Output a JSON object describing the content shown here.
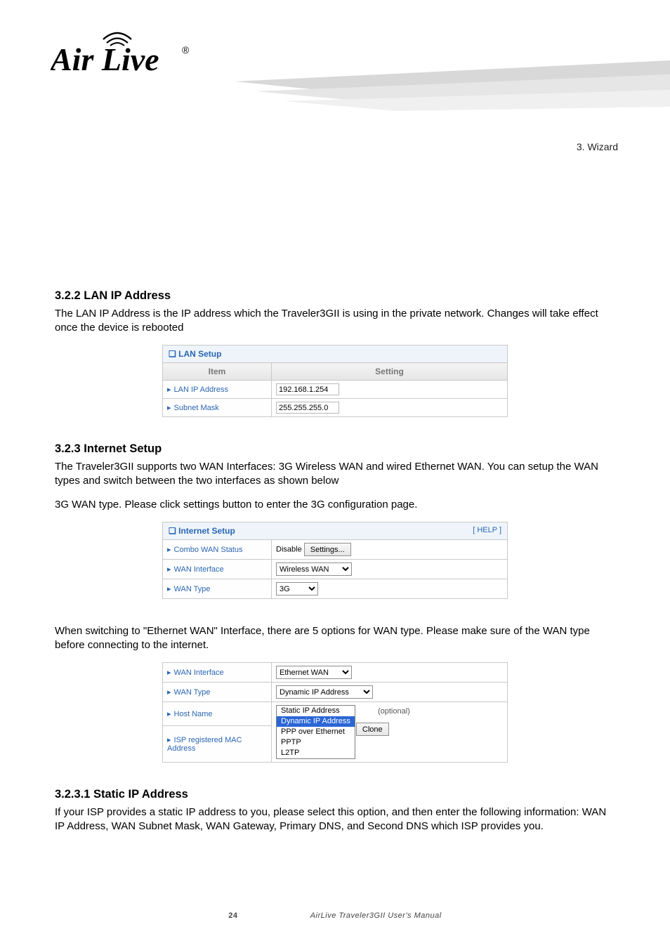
{
  "header": {
    "brand_line1": "Air",
    "brand_line2": "Live",
    "chapter_a": "3. Wizard",
    "chapter_b": ""
  },
  "lan": {
    "section_title": "3.2.2 LAN IP Address",
    "section_body": "The LAN IP Address is the IP address which the Traveler3GII is using in the private network. Changes will take effect once the device is rebooted",
    "panel_title": "LAN Setup",
    "col_item": "Item",
    "col_setting": "Setting",
    "row1_label": "LAN IP Address",
    "row1_value": "192.168.1.254",
    "row2_label": "Subnet Mask",
    "row2_value": "255.255.255.0"
  },
  "internet": {
    "section_title": "3.2.3 Internet Setup",
    "para1": "The Traveler3GII supports two WAN Interfaces: 3G Wireless WAN and wired Ethernet WAN. You can setup the WAN types and switch between the two interfaces as shown below",
    "para2": "3G WAN type. Please click settings button to enter the 3G configuration page.",
    "panel_title": "Internet Setup",
    "help_label": "[ HELP ]",
    "row1_label": "Combo WAN Status",
    "row1_status": "Disable",
    "row1_btn": "Settings...",
    "row2_label": "WAN Interface",
    "row2_sel": "Wireless WAN",
    "row3_label": "WAN Type",
    "row3_sel": "3G"
  },
  "ether": {
    "para": "When switching to \"Ethernet WAN\" Interface, there are 5 options for WAN type. Please make sure of the WAN type before connecting to the internet.",
    "row1_label": "WAN Interface",
    "row1_sel": "Ethernet WAN",
    "row2_label": "WAN Type",
    "row2_sel_label": "Dynamic IP Address",
    "options": [
      "Static IP Address",
      "Dynamic IP Address",
      "PPP over Ethernet",
      "PPTP",
      "L2TP"
    ],
    "row3_label": "Host Name",
    "row3_optional": "(optional)",
    "row4_label": "ISP registered MAC Address",
    "row4_btn": "Clone"
  },
  "static": {
    "section_title": "3.2.3.1 Static IP Address",
    "body": "If your ISP provides a static IP address to you, please select this option, and then enter the following information: WAN IP Address, WAN Subnet Mask, WAN Gateway, Primary DNS, and Second DNS which ISP provides you."
  },
  "footer": {
    "page": "24",
    "manual": "AirLive Traveler3GII User's Manual"
  }
}
